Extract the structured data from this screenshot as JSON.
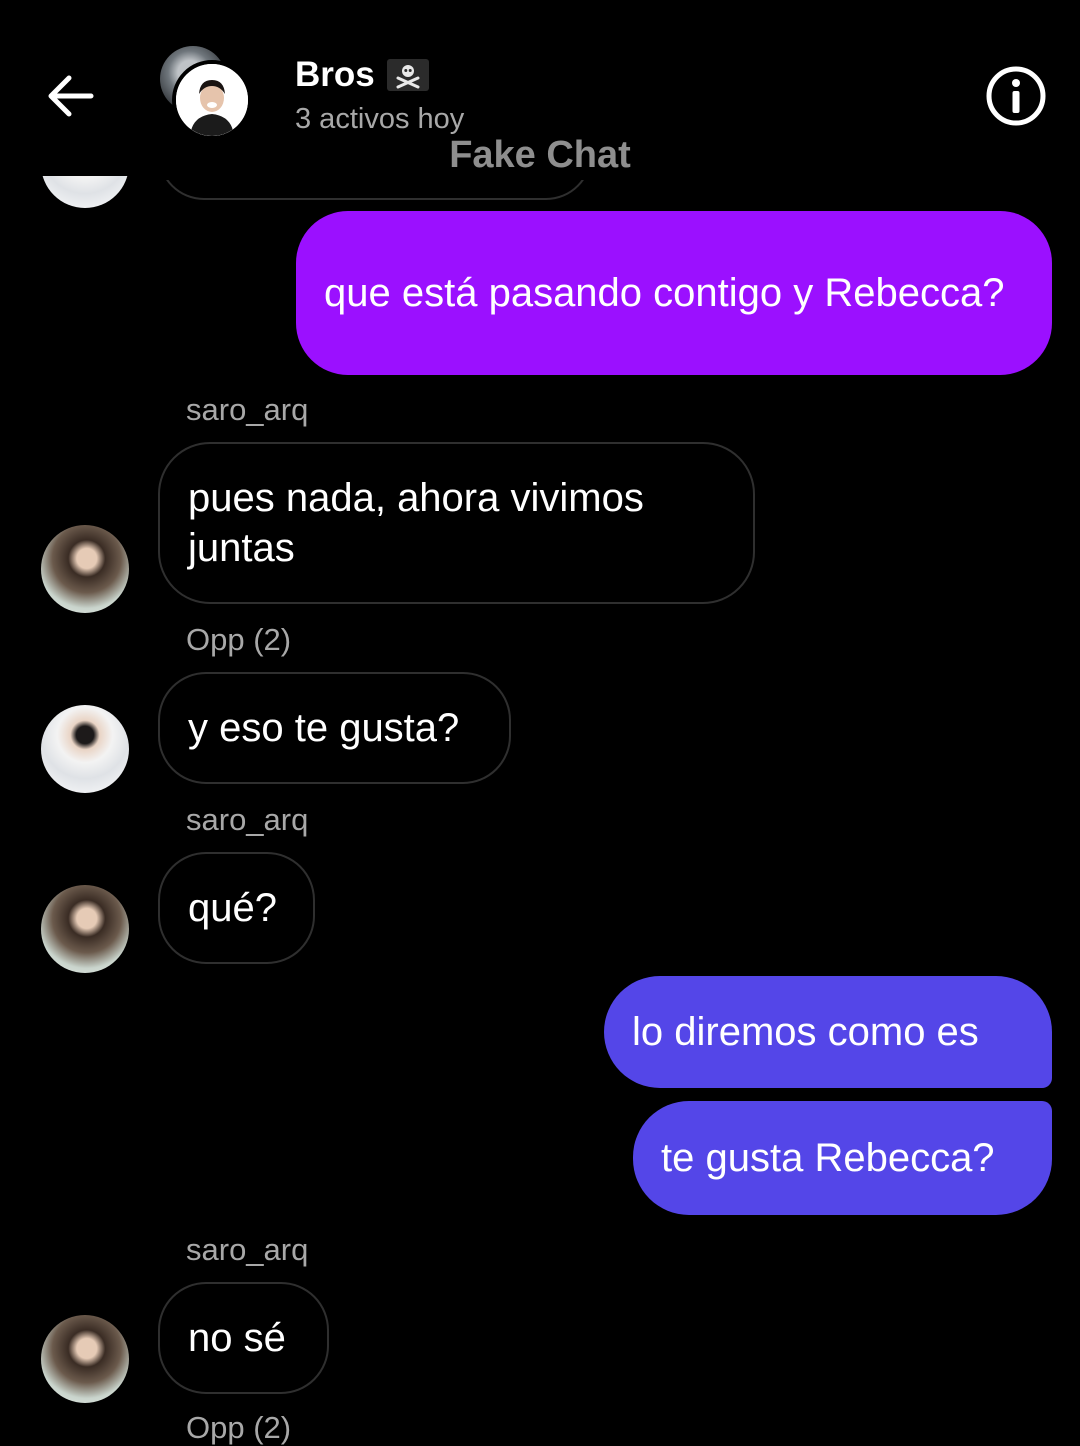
{
  "header": {
    "back_icon": "arrow-left-icon",
    "title": "Bros",
    "title_emoji": "pirate-flag-icon",
    "subtitle": "3 activos hoy",
    "watermark": "Fake Chat",
    "info_icon": "info-circle-icon"
  },
  "colors": {
    "background": "#000000",
    "outgoing_purple": "#9B10FF",
    "outgoing_indigo": "#5446E8",
    "incoming_border": "#2F2F2F",
    "secondary_text": "#A8A8A8"
  },
  "messages": [
    {
      "from": "me",
      "text": "que está pasando contigo y Rebecca?"
    },
    {
      "sender": "saro_arq",
      "text": "pues nada, ahora vivimos juntas"
    },
    {
      "sender": "Opp (2)",
      "text": "y eso te gusta?"
    },
    {
      "sender": "saro_arq",
      "text": "qué?"
    },
    {
      "from": "me",
      "text": "lo diremos como es"
    },
    {
      "from": "me",
      "text": "te gusta Rebecca?"
    },
    {
      "sender": "saro_arq",
      "text": "no sé"
    },
    {
      "sender": "Opp (2)"
    }
  ]
}
